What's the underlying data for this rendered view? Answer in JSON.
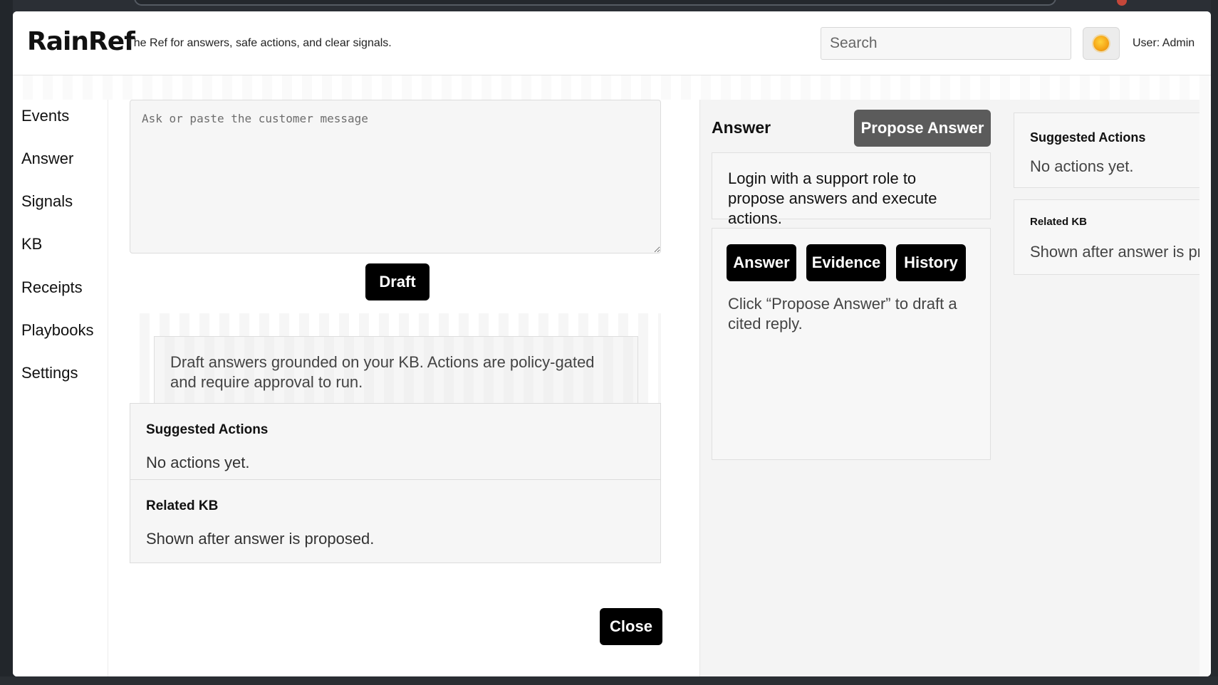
{
  "header": {
    "logo": "RainRef",
    "tagline": "The Ref for answers, safe actions, and clear signals.",
    "search_placeholder": "Search",
    "theme_icon": "sun-icon",
    "user": "User: Admin"
  },
  "sidebar": {
    "items": [
      {
        "label": "Events"
      },
      {
        "label": "Answer"
      },
      {
        "label": "Signals"
      },
      {
        "label": "KB"
      },
      {
        "label": "Receipts"
      },
      {
        "label": "Playbooks"
      },
      {
        "label": "Settings"
      }
    ]
  },
  "compose": {
    "placeholder": "Ask or paste the customer message",
    "value": "",
    "draft_label": "Draft",
    "info": "Draft answers grounded on your KB. Actions are policy-gated and require approval to run."
  },
  "center_cards": {
    "suggested_title": "Suggested Actions",
    "suggested_body": "No actions yet.",
    "related_title": "Related KB",
    "related_body": "Shown after answer is proposed."
  },
  "close_label": "Close",
  "answer_panel": {
    "heading": "Answer",
    "propose_label": "Propose Answer",
    "login_note": "Login with a support role to propose answers and execute actions.",
    "tabs": [
      {
        "label": "Answer"
      },
      {
        "label": "Evidence"
      },
      {
        "label": "History"
      }
    ],
    "hint": "Click “Propose Answer” to draft a cited reply."
  },
  "side_panel": {
    "suggested_title": "Suggested Actions",
    "suggested_body": "No actions yet.",
    "related_title": "Related KB",
    "related_body": "Shown after answer is proposed."
  },
  "colors": {
    "primary_button": "#000000",
    "disabled_button": "#5b5b5b",
    "theme_sun": "#f5a316"
  }
}
